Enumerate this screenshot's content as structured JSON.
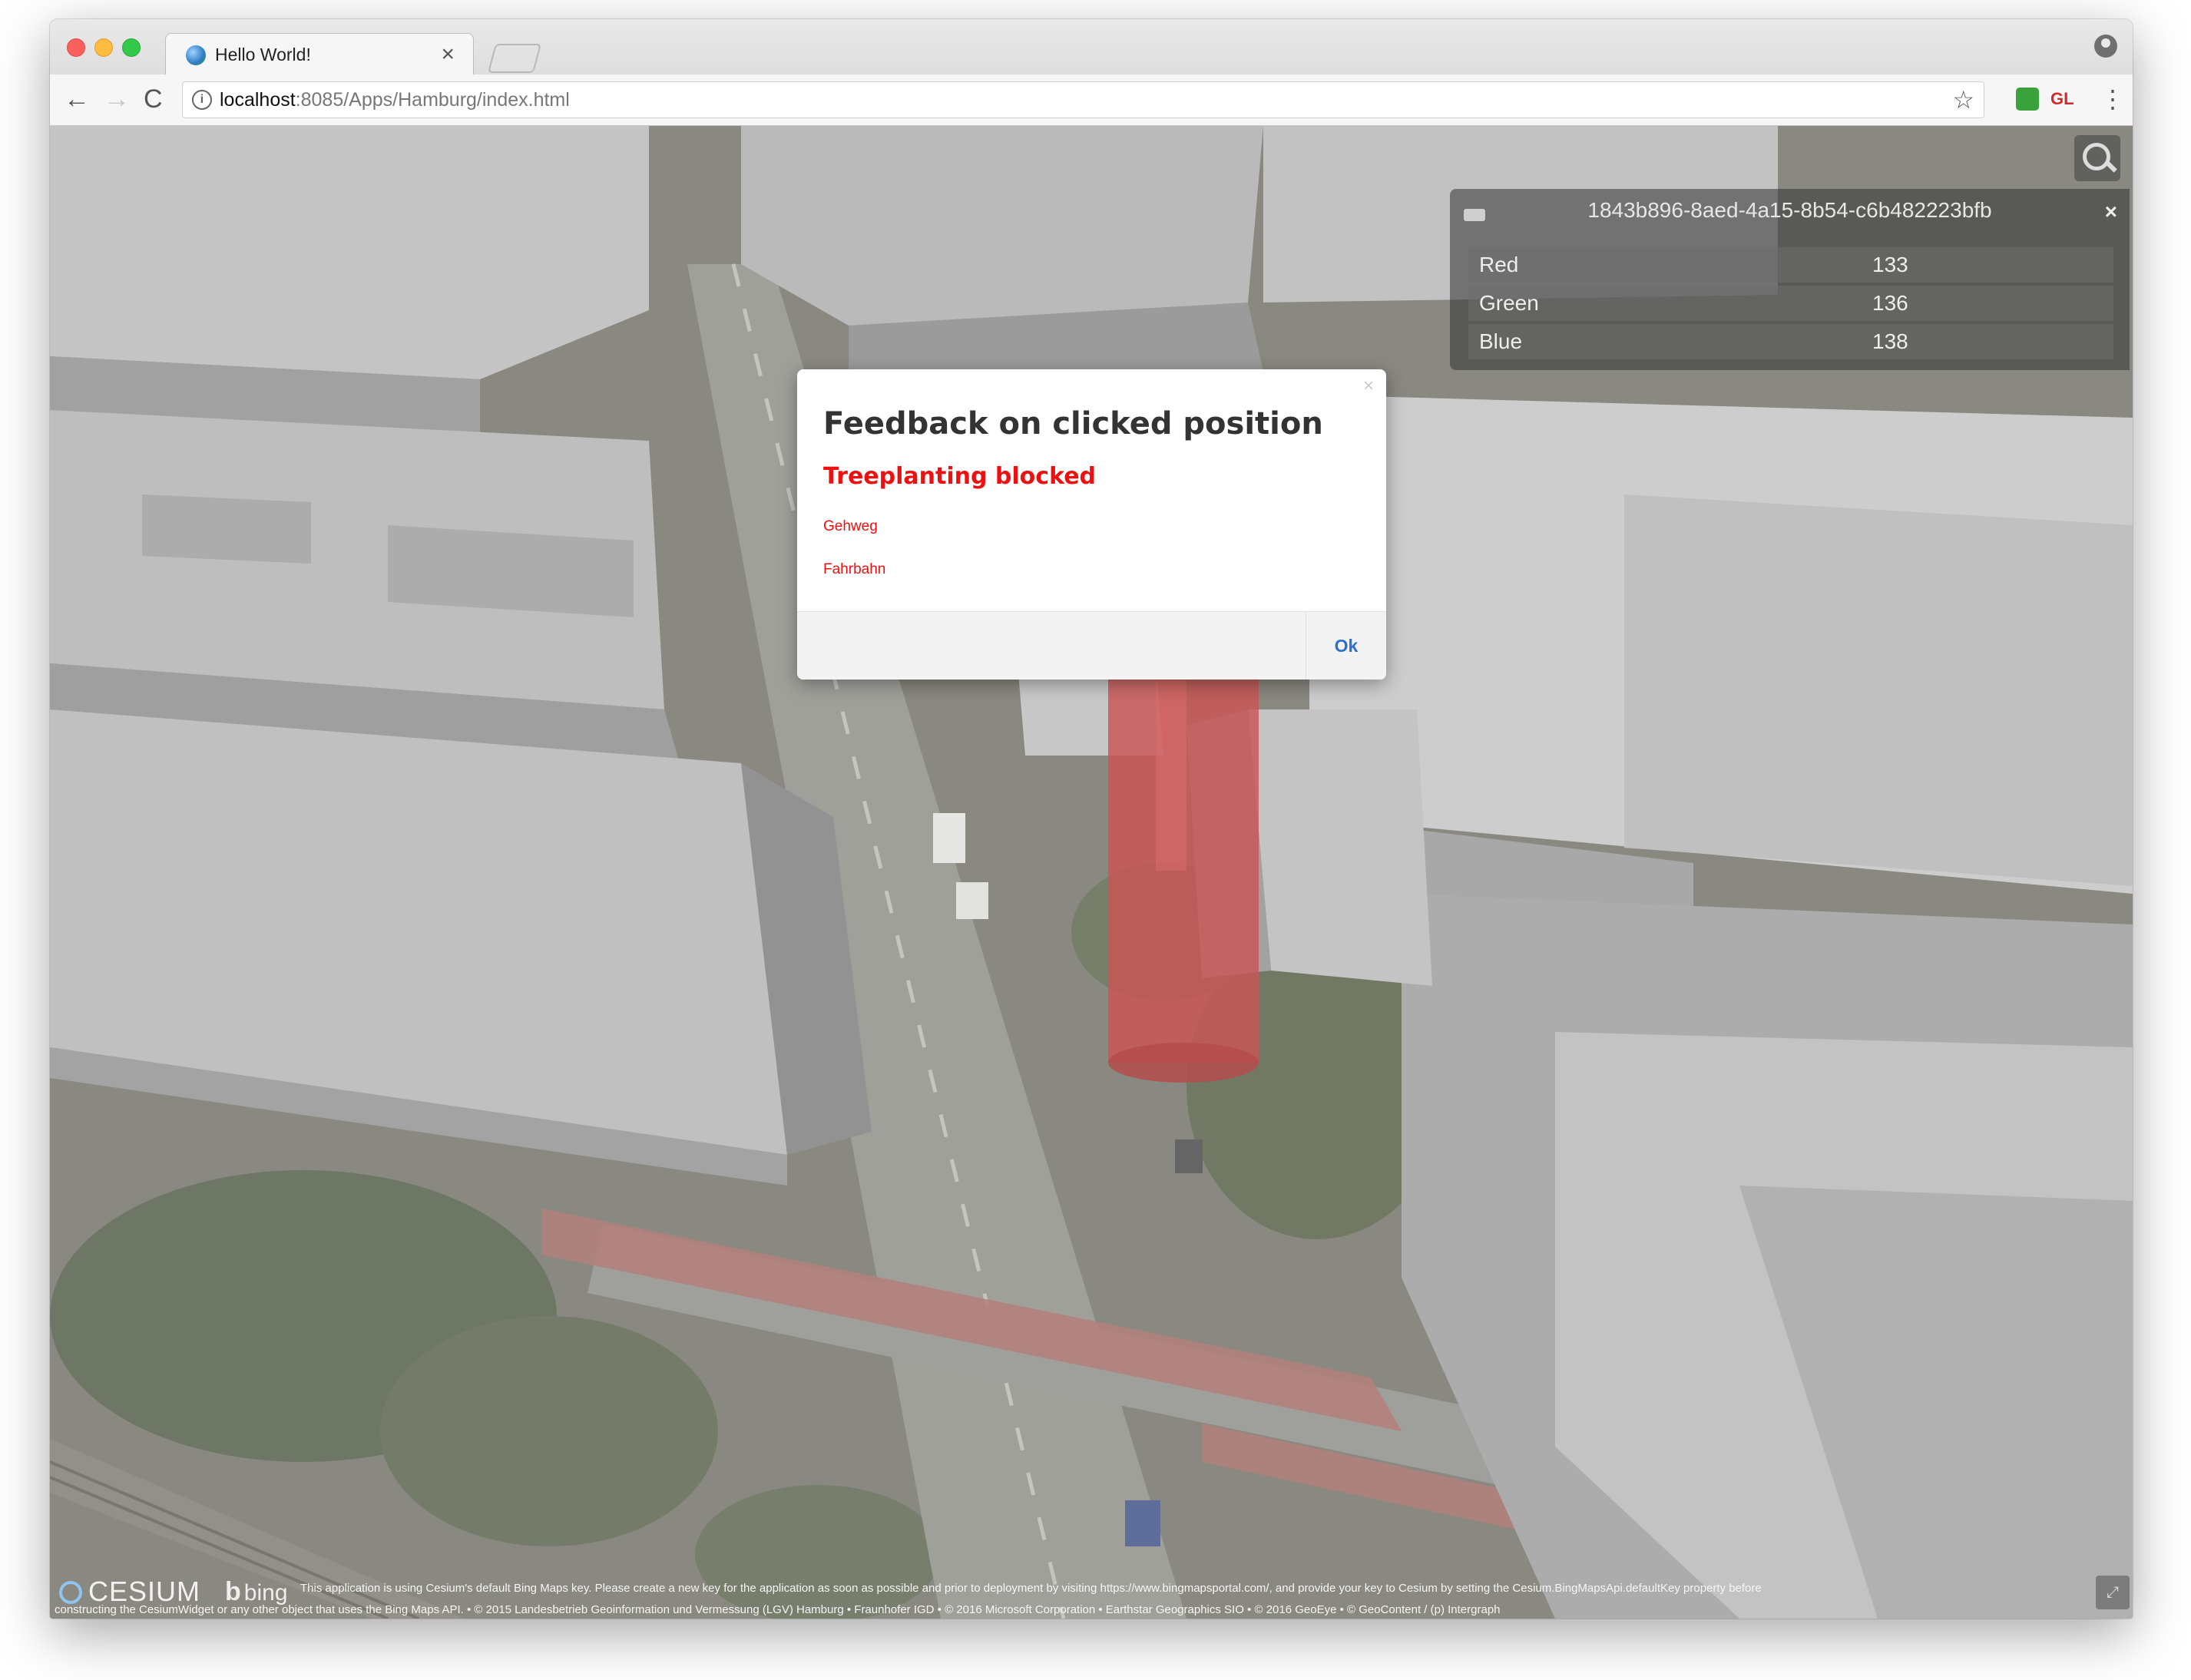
{
  "browser": {
    "tab_title": "Hello World!",
    "tab_close": "×",
    "url_host": "localhost",
    "url_rest": ":8085/Apps/Hamburg/index.html",
    "ext_gl": "GL",
    "nav_back": "←",
    "nav_forward": "→",
    "nav_reload": "C",
    "info": "i",
    "star": "☆",
    "menu": "⋮"
  },
  "infobox": {
    "title": "1843b896-8aed-4a15-8b54-c6b482223bfb",
    "close": "×",
    "rows": [
      {
        "label": "Red",
        "value": "133"
      },
      {
        "label": "Green",
        "value": "136"
      },
      {
        "label": "Blue",
        "value": "138"
      }
    ]
  },
  "modal": {
    "close": "×",
    "title": "Feedback on clicked position",
    "status": "Treeplanting blocked",
    "reasons": [
      "Gehweg",
      "Fahrbahn"
    ],
    "ok_label": "Ok"
  },
  "credits": {
    "cesium": "CESIUM",
    "bing": "bing",
    "line1": "This application is using Cesium's default Bing Maps key. Please create a new key for the application as soon as possible and prior to deployment by visiting https://www.bingmapsportal.com/, and provide your key to Cesium by setting the Cesium.BingMapsApi.defaultKey property before",
    "line2": "constructing the CesiumWidget or any other object that uses the Bing Maps API. • © 2015 Landesbetrieb Geoinformation und Vermessung (LGV) Hamburg • Fraunhofer IGD • © 2016 Microsoft Corporation • Earthstar Geographics SIO • © 2016 GeoEye • © GeoContent / (p) Intergraph"
  },
  "colors": {
    "status_red": "#ee1010",
    "ok_blue": "#2d6fd0",
    "cylinder_red": "#c03030"
  }
}
